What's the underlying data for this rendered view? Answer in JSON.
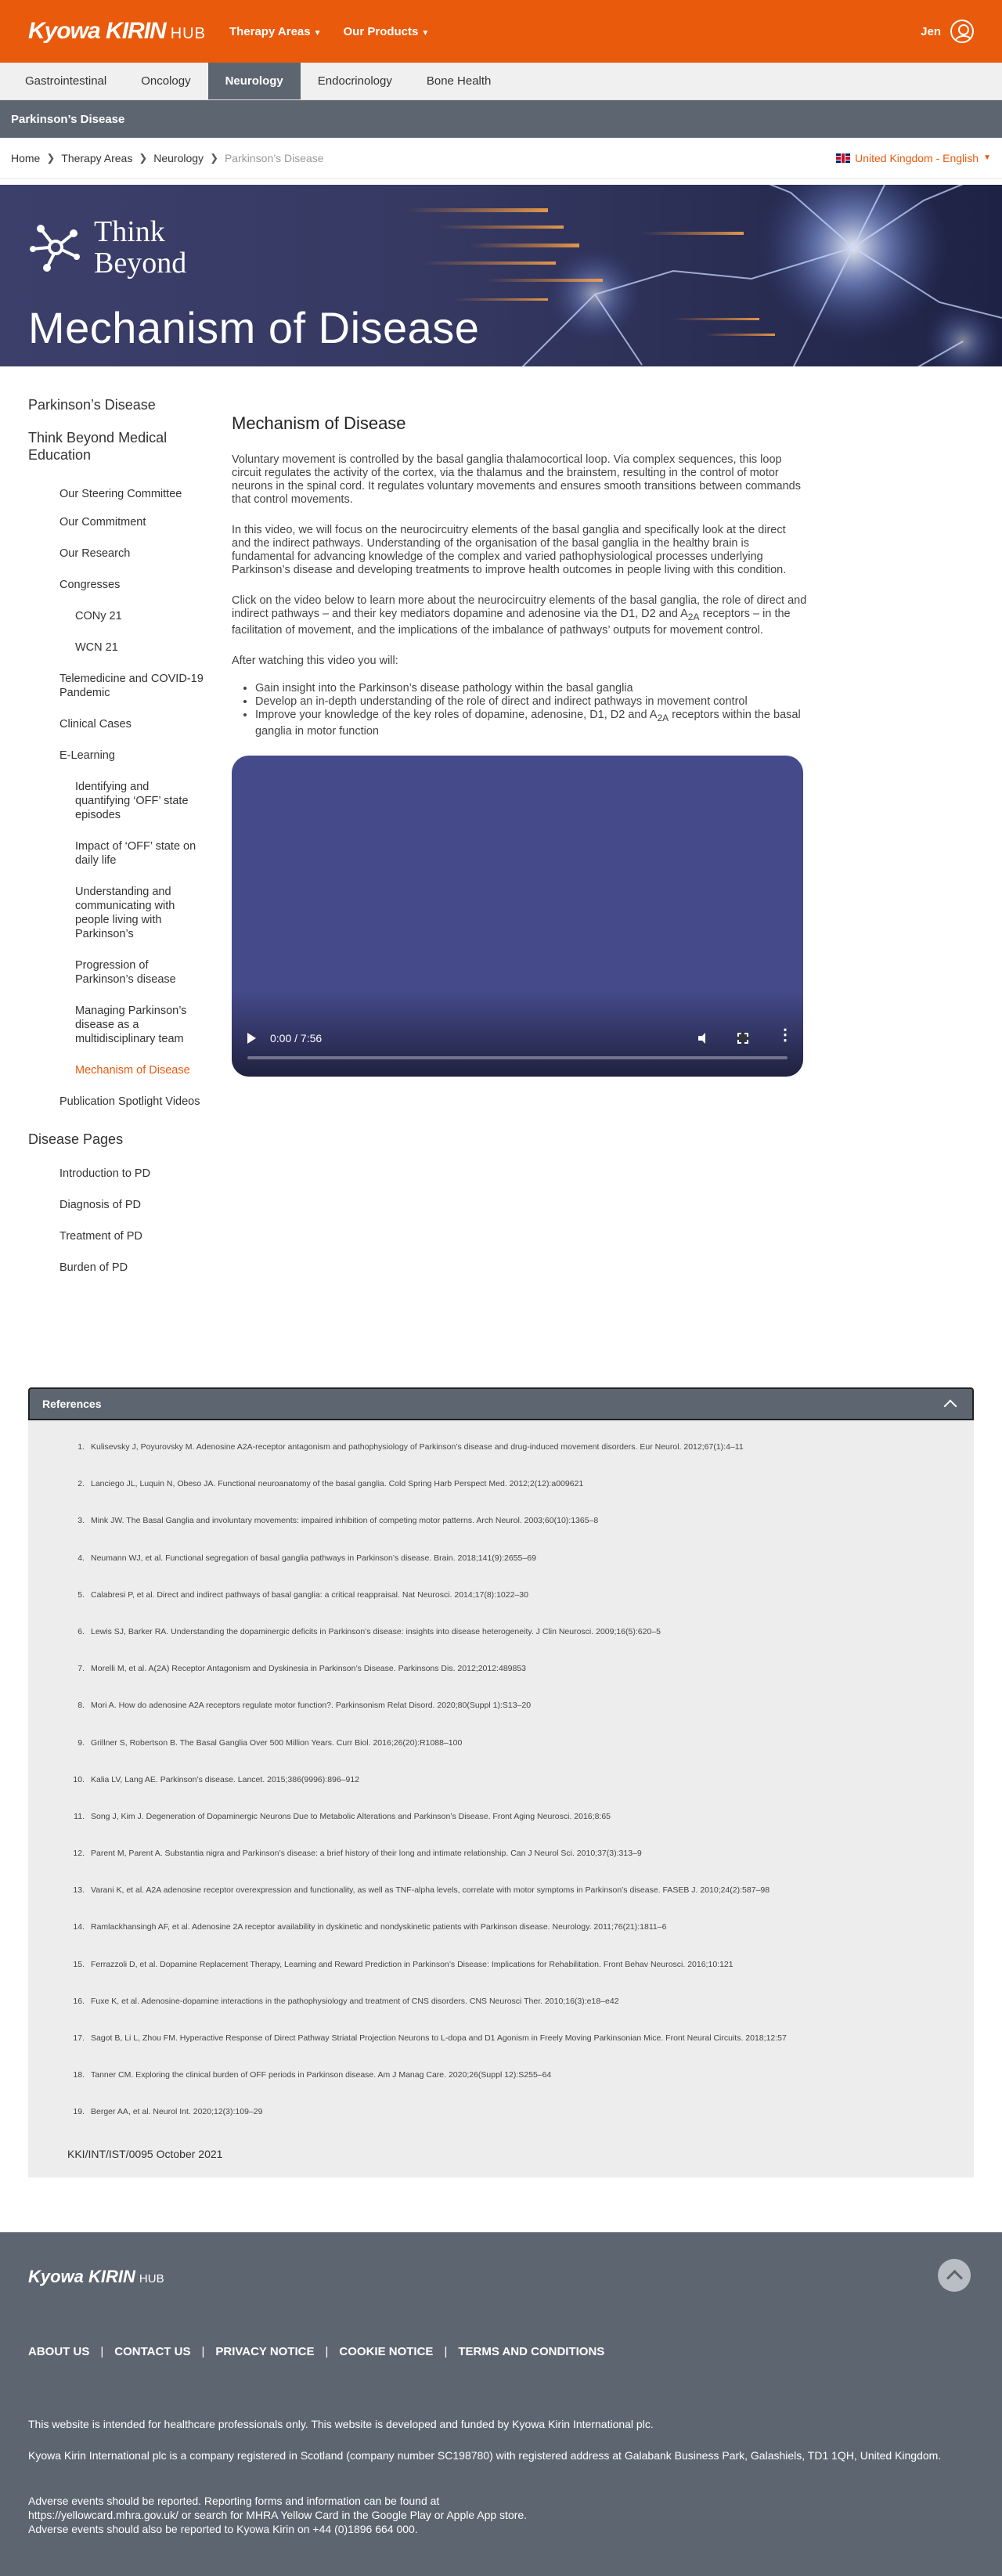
{
  "header": {
    "brand": "Kyowa KIRIN",
    "hub": "HUB",
    "nav": [
      "Therapy Areas",
      "Our Products"
    ],
    "user": "Jen"
  },
  "subnav": {
    "items": [
      "Gastrointestinal",
      "Oncology",
      "Neurology",
      "Endocrinology",
      "Bone Health"
    ],
    "active": "Neurology"
  },
  "page_bar": {
    "title": "Parkinson’s Disease"
  },
  "breadcrumbs": [
    "Home",
    "Therapy Areas",
    "Neurology",
    "Parkinson’s Disease"
  ],
  "locale": "United Kingdom - English",
  "hero": {
    "brand_line1": "Think",
    "brand_line2": "Beyond",
    "title": "Mechanism of Disease"
  },
  "sidebar": {
    "heading1": "Parkinson’s Disease",
    "heading2": "Think Beyond Medical Education",
    "items": [
      {
        "label": "Our Steering Committee",
        "level": 1
      },
      {
        "label": "Our Commitment",
        "level": 1
      },
      {
        "label": "Our Research",
        "level": 1
      },
      {
        "label": "Congresses",
        "level": 1
      },
      {
        "label": "CONy 21",
        "level": 2
      },
      {
        "label": "WCN 21",
        "level": 2
      },
      {
        "label": "Telemedicine and COVID-19 Pandemic",
        "level": 1
      },
      {
        "label": "Clinical Cases",
        "level": 1
      },
      {
        "label": "E-Learning",
        "level": 1
      },
      {
        "label": "Identifying and quantifying ‘OFF’ state episodes",
        "level": 2
      },
      {
        "label": "Impact of ‘OFF’ state on daily life",
        "level": 2
      },
      {
        "label": "Understanding and communicating with people living with Parkinson’s",
        "level": 2
      },
      {
        "label": "Progression of Parkinson’s disease",
        "level": 2
      },
      {
        "label": "Managing Parkinson’s disease as a multidisciplinary team",
        "level": 2
      },
      {
        "label": "Mechanism of Disease",
        "level": 2,
        "active": true
      },
      {
        "label": "Publication Spotlight Videos",
        "level": 1
      }
    ],
    "heading3": "Disease Pages",
    "disease_pages": [
      "Introduction to PD",
      "Diagnosis of PD",
      "Treatment of PD",
      "Burden of PD"
    ]
  },
  "main": {
    "title": "Mechanism of Disease",
    "p1": "Voluntary movement is controlled by the basal ganglia thalamocortical loop. Via complex sequences, this loop circuit regulates the activity of the cortex, via the thalamus and the brainstem, resulting in the control of motor neurons in the spinal cord. It regulates voluntary movements and ensures smooth transitions between commands that control movements.",
    "p2": "In this video, we will focus on the neurocircuitry elements of the basal ganglia and specifically look at the direct and the indirect pathways. Understanding of the organisation of the basal ganglia in the healthy brain is fundamental for advancing knowledge of the complex and varied pathophysiological processes underlying Parkinson’s disease and developing treatments to improve health outcomes in people living with this condition.",
    "p3_a": "Click on the video below to learn more about the neurocircuitry elements of the basal ganglia, the role of direct and indirect pathways – and their key mediators dopamine and adenosine via the D1, D2 and A",
    "p3_sub": "2A",
    "p3_b": " receptors – in the facilitation of movement, and the implications of the imbalance of pathways’ outputs for movement control.",
    "p4": "After watching this video you will:",
    "bullet1": "Gain insight into the Parkinson’s disease pathology within the basal ganglia",
    "bullet2": "Develop an in-depth understanding of the role of direct and indirect pathways in movement control",
    "bullet3_a": "Improve your knowledge of the key roles of dopamine, adenosine, D1, D2 and A",
    "bullet3_sub": "2A",
    "bullet3_b": " receptors within the basal ganglia in motor function",
    "video_time": "0:00 / 7:56",
    "video_progress": 0
  },
  "references": {
    "title": "References",
    "items": [
      "Kulisevsky J, Poyurovsky M. Adenosine A2A-receptor antagonism and pathophysiology of Parkinson’s disease and drug-induced movement disorders. Eur Neurol. 2012;67(1):4–11",
      "Lanciego JL, Luquin N, Obeso JA. Functional neuroanatomy of the basal ganglia. Cold Spring Harb Perspect Med. 2012;2(12):a009621",
      "Mink JW. The Basal Ganglia and involuntary movements: impaired inhibition of competing motor patterns. Arch Neurol. 2003;60(10):1365–8",
      "Neumann WJ, et al. Functional segregation of basal ganglia pathways in Parkinson’s disease. Brain. 2018;141(9):2655–69",
      "Calabresi P, et al. Direct and indirect pathways of basal ganglia: a critical reappraisal. Nat Neurosci. 2014;17(8):1022–30",
      "Lewis SJ, Barker RA. Understanding the dopaminergic deficits in Parkinson’s disease: insights into disease heterogeneity. J Clin Neurosci. 2009;16(5):620–5",
      "Morelli M, et al. A(2A) Receptor Antagonism and Dyskinesia in Parkinson’s Disease. Parkinsons Dis. 2012;2012:489853",
      "Mori A. How do adenosine A2A receptors regulate motor function?. Parkinsonism Relat Disord. 2020;80(Suppl 1):S13–20",
      "Grillner S, Robertson B. The Basal Ganglia Over 500 Million Years. Curr Biol. 2016;26(20):R1088–100",
      "Kalia LV, Lang AE. Parkinson’s disease. Lancet. 2015;386(9996):896–912",
      "Song J, Kim J. Degeneration of Dopaminergic Neurons Due to Metabolic Alterations and Parkinson’s Disease. Front Aging Neurosci. 2016;8:65",
      "Parent M, Parent A. Substantia nigra and Parkinson’s disease: a brief history of their long and intimate relationship. Can J Neurol Sci. 2010;37(3):313–9",
      "Varani K, et al. A2A adenosine receptor overexpression and functionality, as well as TNF-alpha levels, correlate with motor symptoms in Parkinson’s disease. FASEB J. 2010;24(2):587–98",
      "Ramlackhansingh AF, et al. Adenosine 2A receptor availability in dyskinetic and nondyskinetic patients with Parkinson disease. Neurology. 2011;76(21):1811–6",
      "Ferrazzoli D, et al. Dopamine Replacement Therapy, Learning and Reward Prediction in Parkinson’s Disease: Implications for Rehabilitation. Front Behav Neurosci. 2016;10:121",
      "Fuxe K, et al. Adenosine-dopamine interactions in the pathophysiology and treatment of CNS disorders. CNS Neurosci Ther. 2010;16(3):e18–e42",
      "Sagot B, Li L, Zhou FM. Hyperactive Response of Direct Pathway Striatal Projection Neurons to L-dopa and D1 Agonism in Freely Moving Parkinsonian Mice. Front Neural Circuits. 2018;12:57",
      "Tanner CM. Exploring the clinical burden of OFF periods in Parkinson disease. Am J Manag Care. 2020;26(Suppl 12):S255–64",
      "Berger AA, et al. Neurol Int. 2020;12(3):109–29"
    ],
    "code": "KKI/INT/IST/0095 October 2021"
  },
  "footer": {
    "brand": "Kyowa KIRIN",
    "hub": "HUB",
    "links": [
      "ABOUT US",
      "CONTACT US",
      "PRIVACY NOTICE",
      "COOKIE NOTICE",
      "TERMS AND CONDITIONS"
    ],
    "note1": "This website is intended for healthcare professionals only. This website is developed and funded by Kyowa Kirin International plc.",
    "note2": "Kyowa Kirin International plc is a company registered in Scotland (company number SC198780) with registered address at Galabank Business Park, Galashiels, TD1 1QH, United Kingdom.",
    "note3a": "Adverse events should be reported. Reporting forms and information can be found at",
    "note3b": "https://yellowcard.mhra.gov.uk/ or search for MHRA Yellow Card in the Google Play or Apple App store.",
    "note3c": "Adverse events should also be reported to Kyowa Kirin on +44 (0)1896 664 000."
  },
  "colors": {
    "brand_orange": "#ea5a0c",
    "slate": "#5d6670",
    "video_bg": "#454a8a"
  }
}
